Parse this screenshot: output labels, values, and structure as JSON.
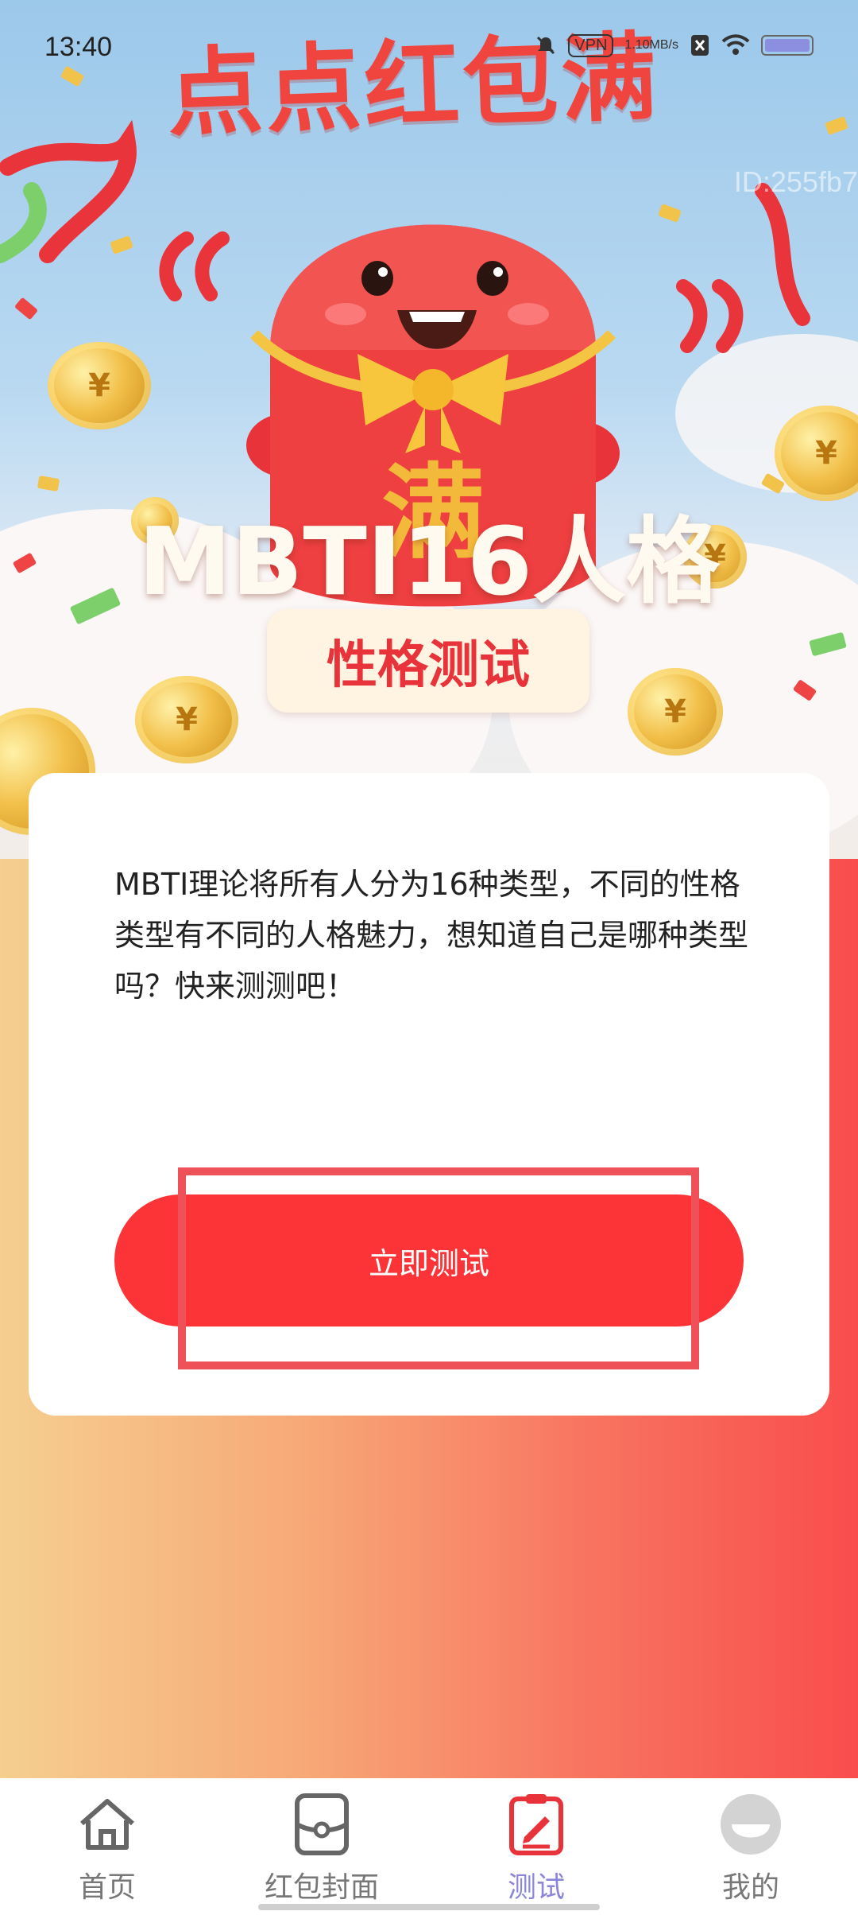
{
  "status_bar": {
    "time": "13:40",
    "vpn": "VPN",
    "net_speed_value": "1.10",
    "net_speed_unit": "MB/s"
  },
  "banner": {
    "brand_title": "点点红包满",
    "id_watermark": "ID:255fb7",
    "mascot_char": "满",
    "title": "MBTI16人格",
    "subtitle": "性格测试"
  },
  "card": {
    "description": "MBTI理论将所有人分为16种类型，不同的性格类型有不同的人格魅力，想知道自己是哪种类型吗？快来测测吧！",
    "start_button": "立即测试"
  },
  "bottom_nav": {
    "items": [
      {
        "label": "首页",
        "icon": "home-icon",
        "active": false
      },
      {
        "label": "红包封面",
        "icon": "cover-icon",
        "active": false
      },
      {
        "label": "测试",
        "icon": "test-icon",
        "active": true
      },
      {
        "label": "我的",
        "icon": "profile-icon",
        "active": false
      }
    ]
  },
  "colors": {
    "primary_red": "#fc3437",
    "active_nav": "#8b86d9",
    "gradient_start": "#f5cf8f",
    "gradient_end": "#f94d4d"
  }
}
